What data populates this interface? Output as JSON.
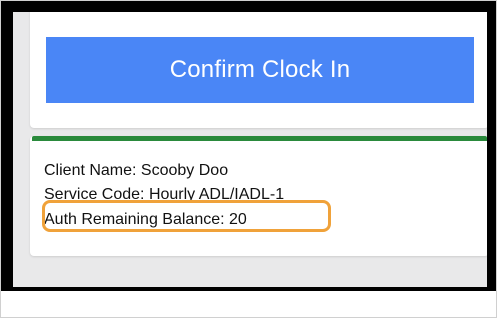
{
  "button": {
    "confirm_label": "Confirm Clock In"
  },
  "client_info": {
    "client_name": "Client Name: Scooby Doo",
    "service_code": "Service Code: Hourly ADL/IADL-1",
    "auth_remaining_balance": "Auth Remaining Balance: 20"
  },
  "colors": {
    "button_blue": "#4a86f6",
    "status_bar_green": "#2a8a3c",
    "highlight_orange": "#f0a23a",
    "background_gray": "#e9e9ea"
  }
}
